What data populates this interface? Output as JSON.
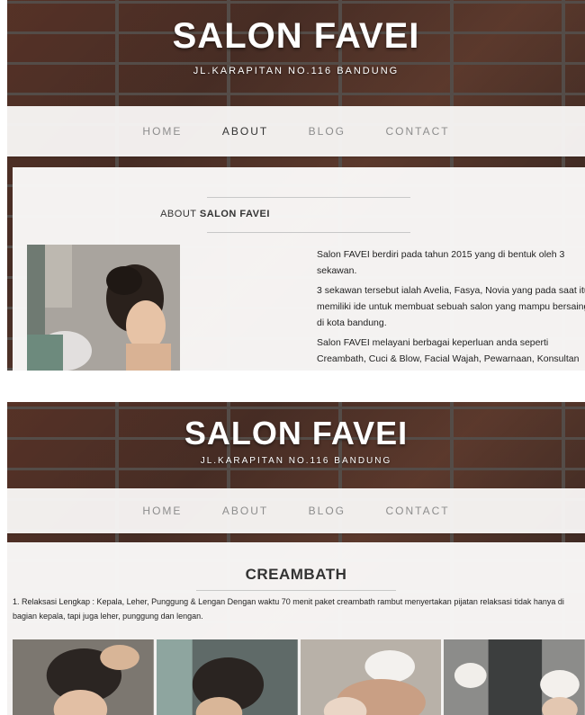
{
  "site": {
    "title": "SALON FAVEI",
    "address": "JL.KARAPITAN NO.116 BANDUNG"
  },
  "nav": {
    "items": [
      "HOME",
      "ABOUT",
      "BLOG",
      "CONTACT"
    ]
  },
  "about_page": {
    "active_nav": "ABOUT",
    "heading_prefix": "ABOUT",
    "heading_bold": "SALON FAVEI",
    "paragraphs": [
      "Salon FAVEI berdiri pada tahun 2015 yang di bentuk oleh 3 sekawan.",
      "3 sekawan tersebut ialah Avelia, Fasya, Novia yang pada saat itu memiliki ide untuk membuat sebuah salon yang mampu bersaing di kota bandung.",
      "Salon FAVEI melayani berbagai keperluan anda seperti Creambath, Cuci & Blow, Facial Wajah, Pewarnaan, Konsultan Perawatan, dll."
    ]
  },
  "creambath_page": {
    "title": "CREAMBATH",
    "description": "1. Relaksasi Lengkap : Kepala, Leher, Punggung & Lengan Dengan waktu 70 menit paket creambath rambut menyertakan pijatan relaksasi tidak hanya di bagian kepala, tapi juga leher, punggung dan lengan."
  },
  "colors": {
    "active_nav": "#333333",
    "inactive_nav": "#8d8d8d",
    "header_text": "#ffffff"
  }
}
